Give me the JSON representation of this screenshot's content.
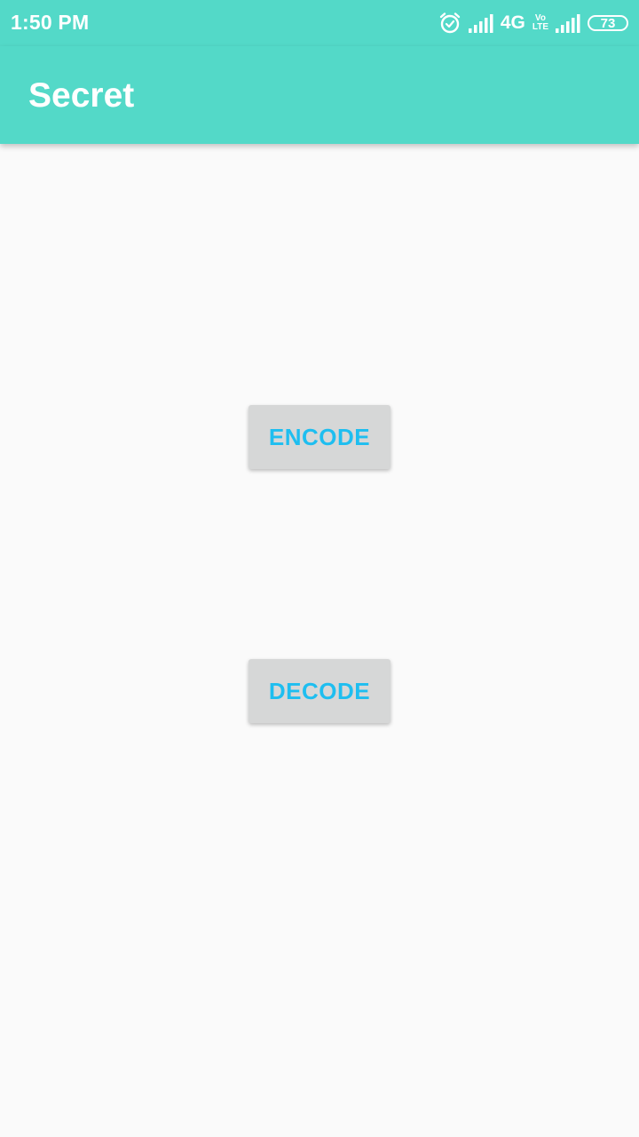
{
  "status_bar": {
    "time": "1:50 PM",
    "network_type": "4G",
    "volte_top": "Vo",
    "volte_bottom": "LTE",
    "battery_level": "73",
    "icons": [
      "alarm-icon",
      "signal-icon",
      "signal-icon-2",
      "battery-icon"
    ]
  },
  "app_bar": {
    "title": "Secret"
  },
  "main": {
    "encode_label": "ENCODE",
    "decode_label": "DECODE"
  },
  "colors": {
    "primary": "#53D9C8",
    "background": "#FAFAFA",
    "button_bg": "#D6D7D7",
    "button_text": "#1EBEF0"
  }
}
